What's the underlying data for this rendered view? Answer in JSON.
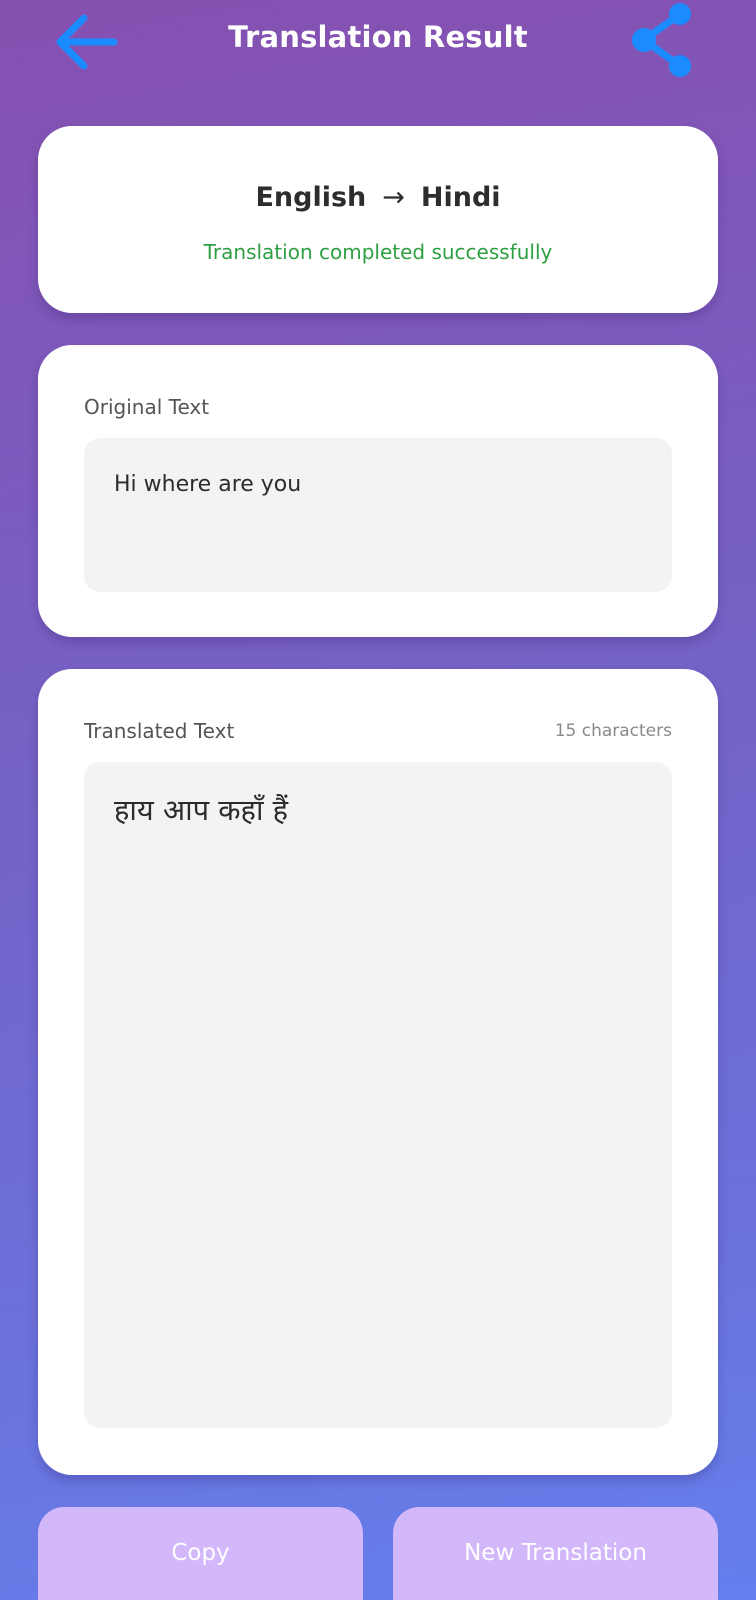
{
  "header": {
    "title": "Translation Result",
    "back_icon": "arrow-left-icon",
    "share_icon": "share-icon",
    "icon_color": "#1a8cff"
  },
  "language_card": {
    "source_language": "English",
    "arrow": "→",
    "target_language": "Hindi",
    "status": "Translation completed successfully",
    "status_color": "#2ea043"
  },
  "original": {
    "label": "Original Text",
    "text": "Hi where are you"
  },
  "translated": {
    "label": "Translated Text",
    "char_count": "15 characters",
    "text": "हाय आप कहाँ हैं"
  },
  "actions": {
    "copy_label": "Copy",
    "new_translation_label": "New Translation",
    "button_color": "#d2b8fb"
  },
  "theme": {
    "gradient_top": "#8650b0",
    "gradient_bottom": "#6480ee"
  }
}
